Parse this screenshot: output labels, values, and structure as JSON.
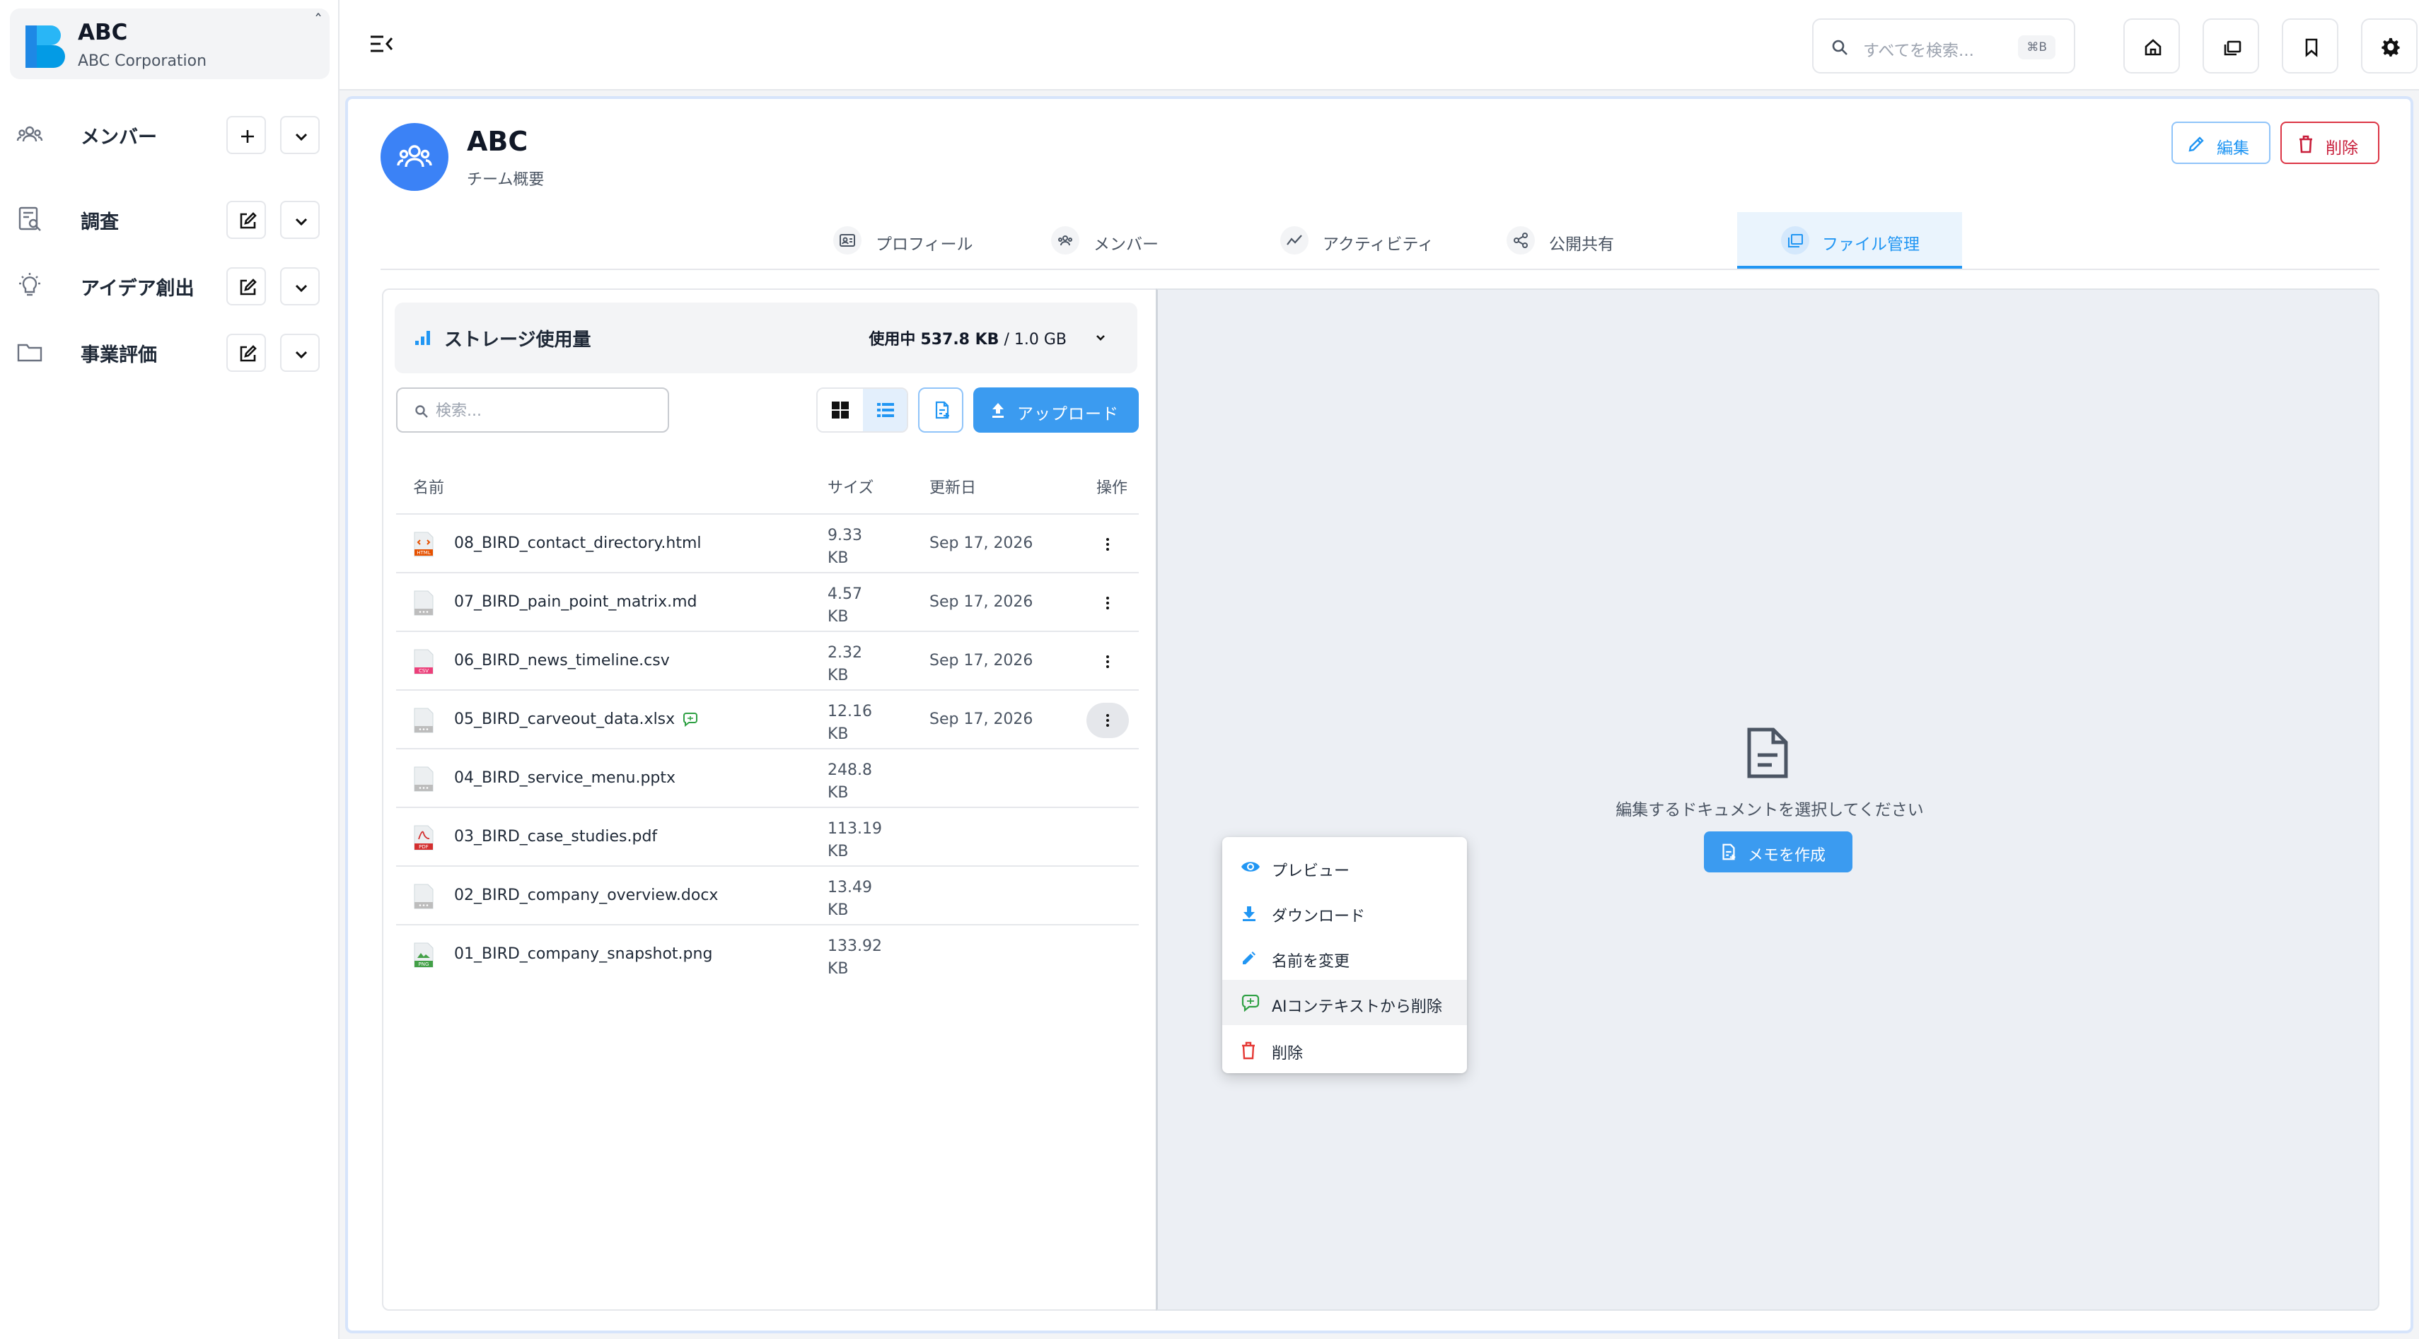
{
  "brand": {
    "name": "ABC",
    "subtitle": "ABC Corporation",
    "toggle": "ˆ"
  },
  "sidebar": {
    "items": [
      {
        "label": "メンバー",
        "icon": "members-icon",
        "action": "add"
      },
      {
        "label": "調査",
        "icon": "research-icon",
        "action": "edit"
      },
      {
        "label": "アイデア創出",
        "icon": "lightbulb-icon",
        "action": "edit"
      },
      {
        "label": "事業評価",
        "icon": "folder-icon",
        "action": "edit"
      }
    ]
  },
  "topbar": {
    "search_placeholder": "すべてを検索...",
    "search_shortcut": "⌘B",
    "buttons": [
      "home-icon",
      "library-icon",
      "bookmark-icon",
      "gear-icon"
    ]
  },
  "team": {
    "name": "ABC",
    "subtitle": "チーム概要",
    "edit_label": "編集",
    "delete_label": "削除"
  },
  "tabs": [
    {
      "label": "プロフィール",
      "icon": "profile-card-icon"
    },
    {
      "label": "メンバー",
      "icon": "members-icon"
    },
    {
      "label": "アクティビティ",
      "icon": "activity-icon"
    },
    {
      "label": "公開共有",
      "icon": "share-icon"
    },
    {
      "label": "ファイル管理",
      "icon": "files-icon",
      "active": true
    }
  ],
  "storage": {
    "title": "ストレージ使用量",
    "used_label": "使用中",
    "used": "537.8 KB",
    "total": "/ 1.0 GB"
  },
  "files": {
    "search_placeholder": "検索...",
    "upload_label": "アップロード",
    "columns": {
      "name": "名前",
      "size": "サイズ",
      "date": "更新日",
      "actions": "操作"
    },
    "rows": [
      {
        "name": "08_BIRD_contact_directory.html",
        "size": "9.33 KB",
        "date": "Sep 17, 2026",
        "type": "HTML"
      },
      {
        "name": "07_BIRD_pain_point_matrix.md",
        "size": "4.57 KB",
        "date": "Sep 17, 2026",
        "type": ""
      },
      {
        "name": "06_BIRD_news_timeline.csv",
        "size": "2.32 KB",
        "date": "Sep 17, 2026",
        "type": "CSV"
      },
      {
        "name": "05_BIRD_carveout_data.xlsx",
        "size": "12.16 KB",
        "date": "Sep 17, 2026",
        "type": "",
        "ai": true
      },
      {
        "name": "04_BIRD_service_menu.pptx",
        "size": "248.8 KB",
        "date": "",
        "type": ""
      },
      {
        "name": "03_BIRD_case_studies.pdf",
        "size": "113.19 KB",
        "date": "",
        "type": "PDF"
      },
      {
        "name": "02_BIRD_company_overview.docx",
        "size": "13.49 KB",
        "date": "",
        "type": ""
      },
      {
        "name": "01_BIRD_company_snapshot.png",
        "size": "133.92 KB",
        "date": "",
        "type": "PNG"
      }
    ]
  },
  "context_menu": {
    "items": [
      {
        "label": "プレビュー",
        "icon": "eye-icon"
      },
      {
        "label": "ダウンロード",
        "icon": "download-icon"
      },
      {
        "label": "名前を変更",
        "icon": "pencil-icon"
      },
      {
        "label": "AIコンテキストから削除",
        "icon": "ai-context-icon"
      },
      {
        "label": "削除",
        "icon": "trash-icon"
      }
    ]
  },
  "editor": {
    "empty_text": "編集するドキュメントを選択してください",
    "memo_label": "メモを作成"
  },
  "colors": {
    "accent": "#2196f3",
    "danger": "#dc3545",
    "ai": "#2ea043"
  }
}
